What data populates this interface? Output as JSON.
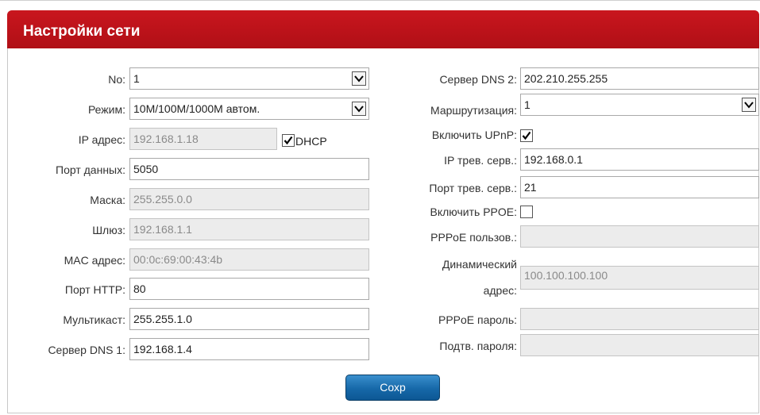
{
  "header": {
    "title": "Настройки сети"
  },
  "left": {
    "no": {
      "label": "No:",
      "value": "1"
    },
    "mode": {
      "label": "Режим:",
      "value": "10M/100M/1000M автом."
    },
    "ip": {
      "label": "IP адрес:",
      "value": "192.168.1.18"
    },
    "dhcp": {
      "label": "DHCP",
      "checked": true
    },
    "data_port": {
      "label": "Порт данных:",
      "value": "5050"
    },
    "mask": {
      "label": "Маска:",
      "value": "255.255.0.0"
    },
    "gateway": {
      "label": "Шлюз:",
      "value": "192.168.1.1"
    },
    "mac": {
      "label": "MAC адрес:",
      "value": "00:0c:69:00:43:4b"
    },
    "http_port": {
      "label": "Порт HTTP:",
      "value": "80"
    },
    "multicast": {
      "label": "Мультикаст:",
      "value": "255.255.1.0"
    },
    "dns1": {
      "label": "Сервер DNS 1:",
      "value": "192.168.1.4"
    }
  },
  "right": {
    "dns2": {
      "label": "Сервер DNS 2:",
      "value": "202.210.255.255"
    },
    "routing": {
      "label": "Маршрутизация:",
      "value": "1"
    },
    "upnp": {
      "label": "Включить UPnP:",
      "checked": true
    },
    "alarm_server_ip": {
      "label": "IP трев. серв.:",
      "value": "192.168.0.1"
    },
    "alarm_server_port": {
      "label": "Порт трев. серв.:",
      "value": "21"
    },
    "pppoe_enable": {
      "label": "Включить PPOE:",
      "checked": false
    },
    "pppoe_user": {
      "label": "PPPoE пользов.:",
      "value": ""
    },
    "dynamic_address": {
      "label_line1": "Динамический",
      "label_line2": "адрес:",
      "value": "100.100.100.100"
    },
    "pppoe_password": {
      "label": "PPPoE пароль:",
      "value": ""
    },
    "password_confirm": {
      "label": "Подтв. пароля:",
      "value": ""
    }
  },
  "actions": {
    "save_label": "Сохр"
  }
}
